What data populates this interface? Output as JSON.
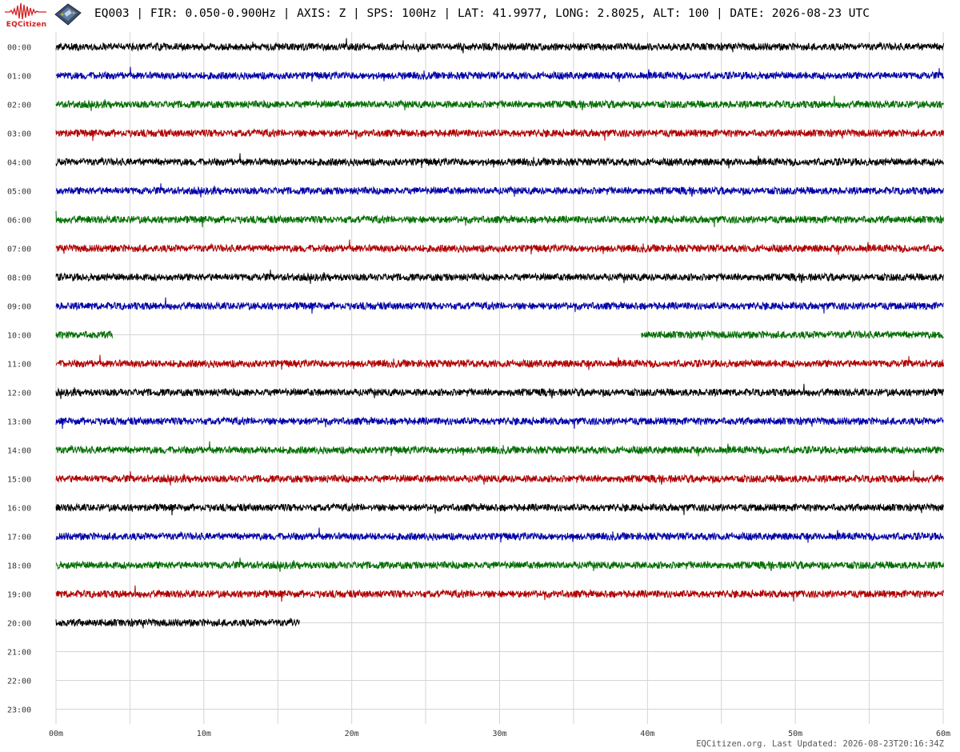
{
  "header": {
    "logo_text": "EQCitizen",
    "title": "EQ003 | FIR: 0.050-0.900Hz | AXIS: Z | SPS: 100Hz | LAT: 41.9977, LONG: 2.8025, ALT: 100 | DATE: 2026-08-23 UTC"
  },
  "footer": {
    "text": "EQCitizen.org. Last Updated: 2026-08-23T20:16:34Z"
  },
  "chart_data": {
    "type": "line",
    "title": "EQ003 | FIR: 0.050-0.900Hz | AXIS: Z | SPS: 100Hz | LAT: 41.9977, LONG: 2.8025, ALT: 100 | DATE: 2026-08-23 UTC",
    "xlabel": "",
    "ylabel": "",
    "xlim": [
      0,
      60
    ],
    "x_ticks": [
      "00m",
      "10m",
      "20m",
      "30m",
      "40m",
      "50m",
      "60m"
    ],
    "x_tick_values": [
      0,
      10,
      20,
      30,
      40,
      50,
      60
    ],
    "y_ticks": [
      "00:00",
      "01:00",
      "02:00",
      "03:00",
      "04:00",
      "05:00",
      "06:00",
      "07:00",
      "08:00",
      "09:00",
      "10:00",
      "11:00",
      "12:00",
      "13:00",
      "14:00",
      "15:00",
      "16:00",
      "17:00",
      "18:00",
      "19:00",
      "20:00",
      "21:00",
      "22:00",
      "23:00"
    ],
    "grid": true,
    "color_cycle": [
      "#000000",
      "#0000a8",
      "#006e00",
      "#b00000"
    ],
    "series": [
      {
        "hour": "00:00",
        "segments": [
          [
            0,
            60
          ]
        ]
      },
      {
        "hour": "01:00",
        "segments": [
          [
            0,
            60
          ]
        ]
      },
      {
        "hour": "02:00",
        "segments": [
          [
            0,
            60
          ]
        ]
      },
      {
        "hour": "03:00",
        "segments": [
          [
            0,
            60
          ]
        ]
      },
      {
        "hour": "04:00",
        "segments": [
          [
            0,
            60
          ]
        ]
      },
      {
        "hour": "05:00",
        "segments": [
          [
            0,
            60
          ]
        ]
      },
      {
        "hour": "06:00",
        "segments": [
          [
            0,
            60
          ]
        ]
      },
      {
        "hour": "07:00",
        "segments": [
          [
            0,
            60
          ]
        ]
      },
      {
        "hour": "08:00",
        "segments": [
          [
            0,
            60
          ]
        ]
      },
      {
        "hour": "09:00",
        "segments": [
          [
            0,
            60
          ]
        ]
      },
      {
        "hour": "10:00",
        "segments": [
          [
            0,
            3.8
          ],
          [
            39.6,
            60
          ]
        ]
      },
      {
        "hour": "11:00",
        "segments": [
          [
            0,
            60
          ]
        ]
      },
      {
        "hour": "12:00",
        "segments": [
          [
            0,
            60
          ]
        ]
      },
      {
        "hour": "13:00",
        "segments": [
          [
            0,
            60
          ]
        ]
      },
      {
        "hour": "14:00",
        "segments": [
          [
            0,
            60
          ]
        ]
      },
      {
        "hour": "15:00",
        "segments": [
          [
            0,
            60
          ]
        ]
      },
      {
        "hour": "16:00",
        "segments": [
          [
            0,
            60
          ]
        ]
      },
      {
        "hour": "17:00",
        "segments": [
          [
            0,
            60
          ]
        ]
      },
      {
        "hour": "18:00",
        "segments": [
          [
            0,
            60
          ]
        ]
      },
      {
        "hour": "19:00",
        "segments": [
          [
            0,
            60
          ]
        ]
      },
      {
        "hour": "20:00",
        "segments": [
          [
            0,
            16.5
          ]
        ]
      }
    ]
  }
}
